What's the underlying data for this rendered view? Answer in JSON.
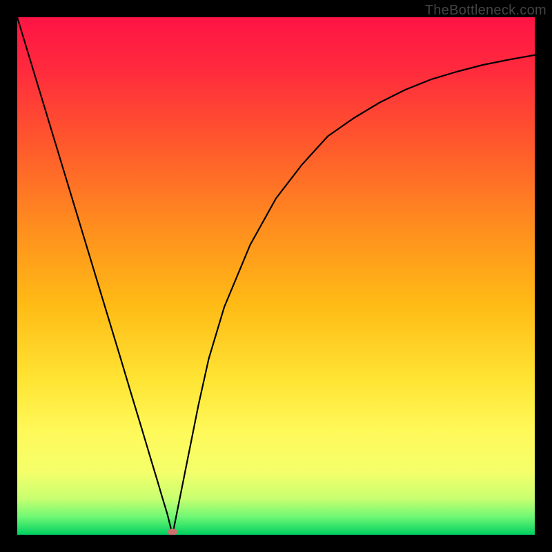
{
  "watermark": "TheBottleneck.com",
  "chart_data": {
    "type": "line",
    "title": "",
    "xlabel": "",
    "ylabel": "",
    "xlim": [
      0,
      100
    ],
    "ylim": [
      0,
      100
    ],
    "grid": false,
    "background": "vertical rainbow gradient red→orange→yellow→green",
    "series": [
      {
        "name": "bottleneck-curve",
        "color": "#000000",
        "x": [
          0,
          5,
          10,
          15,
          20,
          22,
          24,
          26,
          27,
          28,
          29,
          30,
          31,
          33,
          35,
          37,
          40,
          45,
          50,
          55,
          60,
          65,
          70,
          75,
          80,
          85,
          90,
          95,
          100
        ],
        "values": [
          100,
          83.5,
          67,
          50.5,
          34,
          27.3,
          20.7,
          14,
          10.7,
          7.3,
          4,
          0,
          5,
          15,
          25,
          34,
          44,
          56,
          65,
          71.5,
          77,
          80.5,
          83.5,
          86,
          88,
          89.5,
          90.8,
          91.8,
          92.7
        ]
      }
    ],
    "marker": {
      "name": "min-point",
      "x": 30,
      "y": 0,
      "color": "#cc7070"
    },
    "gradient_stops": [
      {
        "pos": 0.0,
        "color": "#ff1445"
      },
      {
        "pos": 0.1,
        "color": "#ff2a3d"
      },
      {
        "pos": 0.25,
        "color": "#ff5a2c"
      },
      {
        "pos": 0.4,
        "color": "#ff8c1f"
      },
      {
        "pos": 0.55,
        "color": "#ffb915"
      },
      {
        "pos": 0.7,
        "color": "#ffe433"
      },
      {
        "pos": 0.8,
        "color": "#fff95a"
      },
      {
        "pos": 0.88,
        "color": "#f4ff6a"
      },
      {
        "pos": 0.93,
        "color": "#c8ff70"
      },
      {
        "pos": 0.965,
        "color": "#70f874"
      },
      {
        "pos": 1.0,
        "color": "#00d060"
      }
    ]
  }
}
